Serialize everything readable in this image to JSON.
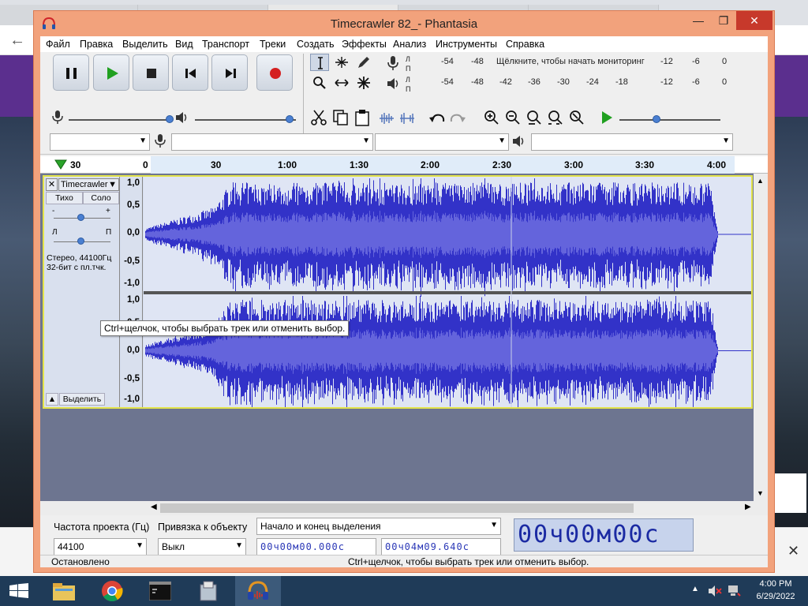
{
  "window": {
    "title": "Timecrawler 82_- Phantasia"
  },
  "menu": [
    "Файл",
    "Правка",
    "Выделить",
    "Вид",
    "Транспорт",
    "Треки",
    "Создать",
    "Эффекты",
    "Анализ",
    "Инструменты",
    "Справка"
  ],
  "meters": {
    "record_scale": [
      "-54",
      "-48",
      "-12",
      "-6",
      "0"
    ],
    "record_hint": "Щёлкните, чтобы начать мониторинг",
    "play_scale": [
      "-54",
      "-48",
      "-42",
      "-36",
      "-30",
      "-24",
      "-18",
      "-12",
      "-6",
      "0"
    ],
    "channel_left": "Л",
    "channel_right": "П"
  },
  "ruler": {
    "labels": [
      "30",
      "0",
      "30",
      "1:00",
      "1:30",
      "2:00",
      "2:30",
      "3:00",
      "3:30",
      "4:00"
    ]
  },
  "track": {
    "name": "Timecrawler",
    "mute": "Тихо",
    "solo": "Соло",
    "pan_left": "Л",
    "pan_right": "П",
    "info1": "Стерео, 44100Гц",
    "info2": "32-бит с пл.тчк.",
    "select": "Выделить",
    "scale": [
      "1,0",
      "0,5",
      "0,0",
      "-0,5",
      "-1,0"
    ]
  },
  "tooltip": "Ctrl+щелчок, чтобы выбрать трек или отменить выбор.",
  "selection_toolbar": {
    "rate_label": "Частота проекта (Гц)",
    "rate_value": "44100",
    "snap_label": "Привязка к объекту",
    "snap_value": "Выкл",
    "mode_value": "Начало и конец выделения",
    "start_time": "00ч00м00.000с",
    "end_time": "00ч04м09.640с",
    "big_time": "00ч00м00с"
  },
  "status": {
    "left": "Остановлено",
    "right": "Ctrl+щелчок, чтобы выбрать трек или отменить выбор."
  },
  "taskbar": {
    "time": "4:00 PM",
    "date": "6/29/2022"
  },
  "colors": {
    "waveform": "#3232c8",
    "waveform_rms": "#6464dc",
    "track_bg": "#dfe5f4",
    "selection": "#e3e34a"
  }
}
